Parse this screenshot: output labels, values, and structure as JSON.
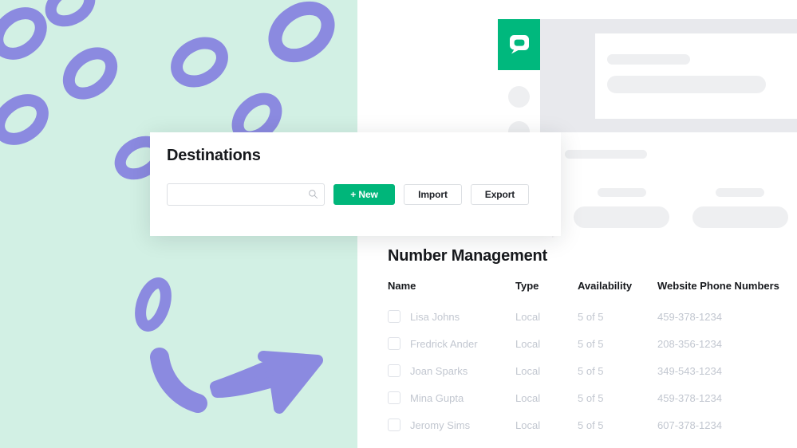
{
  "theme": {
    "mint_background": "#d2f0e4",
    "doodle_purple": "#8b8ae0",
    "brand_green": "#00b67a",
    "logo_green": "#00b87d",
    "skeleton_gray": "#eeeff1",
    "panel_gray": "#e8e9ed",
    "muted_text": "#c2c7d0",
    "heading_text": "#16181c"
  },
  "app_mockup": {
    "logo_icon": "chat-bubble-icon",
    "nav_items": [
      "nav-placeholder-1",
      "nav-placeholder-2"
    ],
    "skeleton_bars": [
      "short-bar",
      "long-bar"
    ]
  },
  "lower_panel": {
    "skeleton_bars": [
      "heading-bar",
      "label-bar-left",
      "label-bar-right",
      "field-bar-left",
      "field-bar-right"
    ]
  },
  "destinations": {
    "title": "Destinations",
    "search": {
      "value": "",
      "placeholder": "",
      "icon": "search-icon"
    },
    "buttons": [
      {
        "label": "+ New",
        "style": "primary",
        "name": "new-button"
      },
      {
        "label": "Import",
        "style": "ghost",
        "name": "import-button"
      },
      {
        "label": "Export",
        "style": "ghost",
        "name": "export-button"
      }
    ]
  },
  "number_management": {
    "title": "Number Management",
    "columns": [
      "Name",
      "Type",
      "Availability",
      "Website Phone Numbers"
    ],
    "rows": [
      {
        "name": "Lisa Johns",
        "type": "Local",
        "availability": "5 of 5",
        "phone": "459-378-1234",
        "checked": false
      },
      {
        "name": "Fredrick Ander",
        "type": "Local",
        "availability": "5 of 5",
        "phone": "208-356-1234",
        "checked": false
      },
      {
        "name": "Joan Sparks",
        "type": "Local",
        "availability": "5 of 5",
        "phone": "349-543-1234",
        "checked": false
      },
      {
        "name": "Mina Gupta",
        "type": "Local",
        "availability": "5 of 5",
        "phone": "459-378-1234",
        "checked": false
      },
      {
        "name": "Jeromy Sims",
        "type": "Local",
        "availability": "5 of 5",
        "phone": "607-378-1234",
        "checked": false
      }
    ]
  },
  "decorations": {
    "shapes": [
      "loop-ring",
      "loop-ring",
      "loop-ring",
      "loop-ring",
      "loop-ring",
      "loop-ring",
      "loop-ring",
      "loop-ring",
      "loop-ring",
      "arrow-right",
      "crescent-stroke"
    ]
  }
}
